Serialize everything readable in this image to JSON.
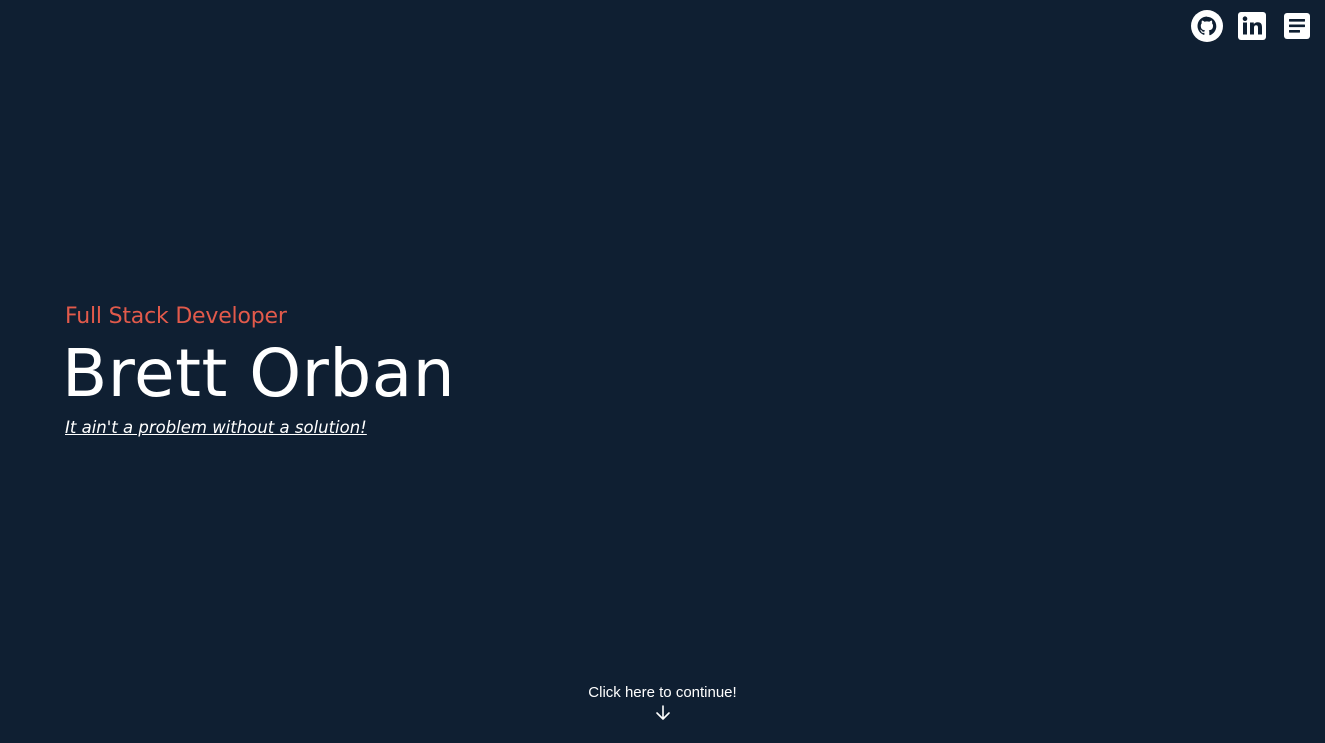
{
  "social": {
    "items": [
      {
        "icon": "github-icon",
        "label": "GitHub"
      },
      {
        "icon": "linkedin-icon",
        "label": "LinkedIn"
      },
      {
        "icon": "resume-icon",
        "label": "Resume"
      }
    ]
  },
  "hero": {
    "role": "Full Stack Developer",
    "name": "Brett Orban",
    "tagline": "It ain't a problem without a solution!"
  },
  "continue": {
    "label": "Click here to continue!",
    "icon": "arrow-down-icon"
  },
  "colors": {
    "background": "#0f1f32",
    "accent": "#e25a4b",
    "text": "#ffffff"
  }
}
